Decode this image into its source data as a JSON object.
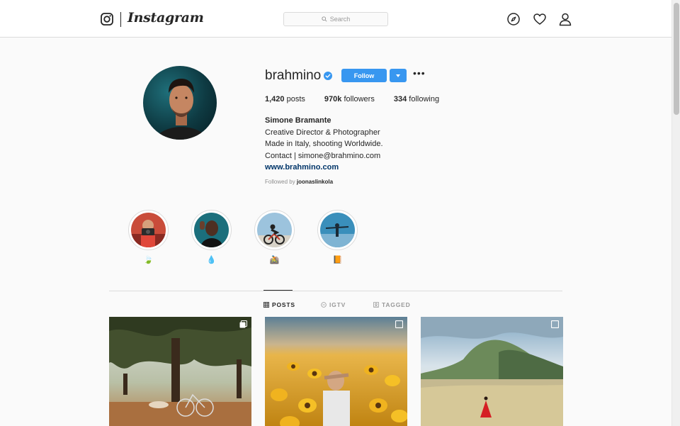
{
  "nav": {
    "wordmark": "Instagram",
    "search_placeholder": "Search",
    "icons": [
      "instagram-glyph-icon",
      "search-icon",
      "compass-icon",
      "heart-icon",
      "user-icon"
    ]
  },
  "profile": {
    "username": "brahmino",
    "verified": true,
    "follow_label": "Follow",
    "more_label": "•••",
    "stats": {
      "posts_value": "1,420",
      "posts_label": "posts",
      "followers_value": "970k",
      "followers_label": "followers",
      "following_value": "334",
      "following_label": "following"
    },
    "full_name": "Simone Bramante",
    "bio_lines": [
      "Creative Director & Photographer",
      "Made in Italy, shooting Worldwide.",
      "Contact | simone@brahmino.com"
    ],
    "website": "www.brahmino.com",
    "followed_by_prefix": "Followed by",
    "followed_by_user": "joonaslinkola"
  },
  "highlights": [
    {
      "emoji": "🍃"
    },
    {
      "emoji": "💧"
    },
    {
      "emoji": "🚵"
    },
    {
      "emoji": "📙"
    }
  ],
  "tabs": [
    {
      "label": "POSTS",
      "active": true
    },
    {
      "label": "IGTV",
      "active": false
    },
    {
      "label": "TAGGED",
      "active": false
    }
  ],
  "colors": {
    "accent": "#3897f0",
    "link": "#003569",
    "border": "#dbdbdb",
    "background": "#fafafa"
  }
}
